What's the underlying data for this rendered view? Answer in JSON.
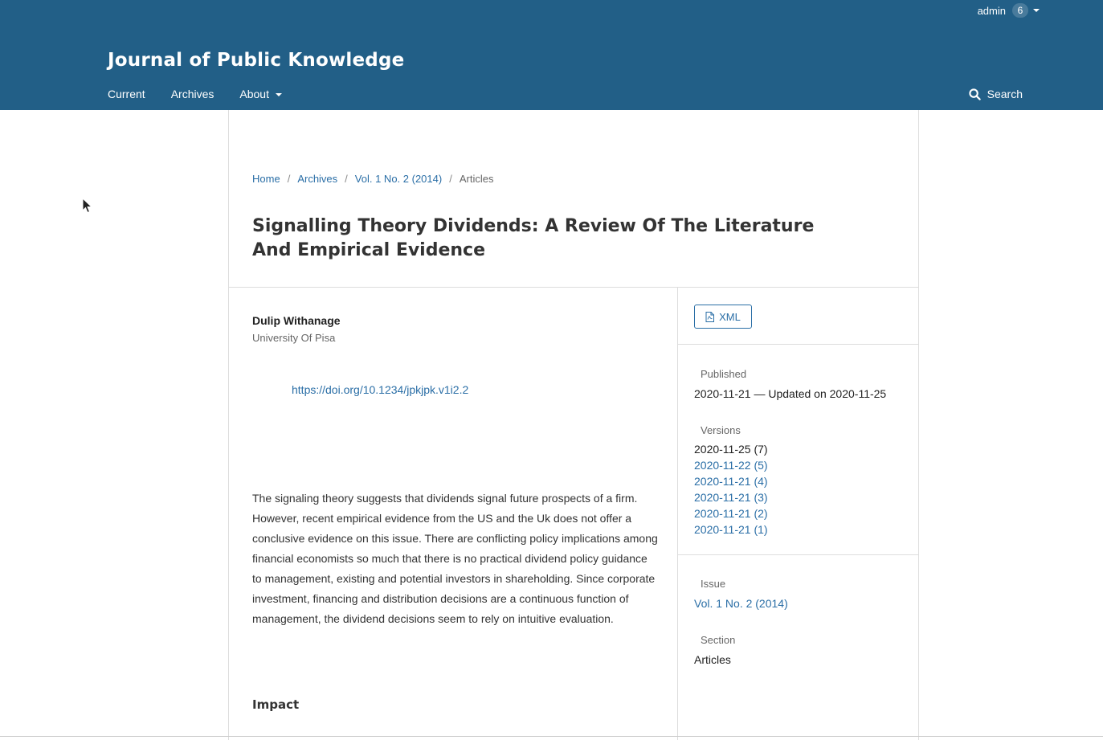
{
  "header": {
    "site_title": "Journal of Public Knowledge",
    "user": {
      "name": "admin",
      "notification_count": "6"
    },
    "nav": [
      {
        "label": "Current"
      },
      {
        "label": "Archives"
      },
      {
        "label": "About"
      }
    ],
    "search_label": "Search"
  },
  "breadcrumb": {
    "items": [
      "Home",
      "Archives",
      "Vol. 1 No. 2 (2014)"
    ],
    "current": "Articles",
    "separator": "/"
  },
  "article": {
    "title": "Signalling Theory Dividends: A Review Of The Literature And Empirical Evidence",
    "author": "Dulip Withanage",
    "affiliation": "University Of Pisa",
    "doi": "https://doi.org/10.1234/jpkjpk.v1i2.2",
    "abstract": "The signaling theory suggests that dividends signal future prospects of a firm. However, recent empirical evidence from the US and the Uk does not offer a conclusive evidence on this issue. There are conflicting policy implications among financial economists so much that there is no practical dividend policy guidance to management, existing and potential investors in shareholding. Since corporate investment, financing and distribution decisions are a continuous function of management, the dividend decisions seem to rely on intuitive evaluation.",
    "impact_heading": "Impact"
  },
  "sidebar": {
    "galley_label": "XML",
    "published_label": "Published",
    "published_value": "2020-11-21 — Updated on 2020-11-25",
    "versions_label": "Versions",
    "current_version": "2020-11-25 (7)",
    "versions": [
      "2020-11-22 (5)",
      "2020-11-21 (4)",
      "2020-11-21 (3)",
      "2020-11-21 (2)",
      "2020-11-21 (1)"
    ],
    "issue_label": "Issue",
    "issue_value": "Vol. 1 No. 2 (2014)",
    "section_label": "Section",
    "section_value": "Articles"
  },
  "colors": {
    "header_bg": "#225f87",
    "link": "#2a6ea6"
  }
}
